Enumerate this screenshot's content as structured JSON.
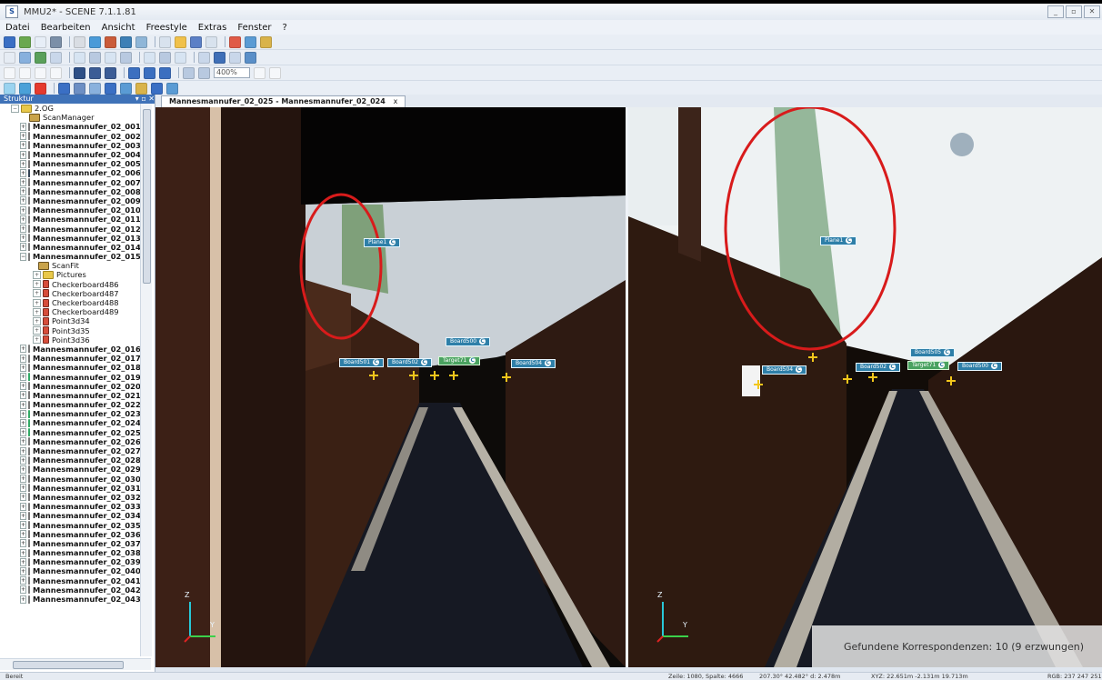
{
  "window": {
    "title": "MMU2* - SCENE 7.1.1.81"
  },
  "menu": [
    "Datei",
    "Bearbeiten",
    "Ansicht",
    "Freestyle",
    "Extras",
    "Fenster",
    "?"
  ],
  "toolbar": {
    "zoom_value": "400%"
  },
  "structure_panel": {
    "title": "Struktur",
    "root": "2.OG",
    "scan_manager": "ScanManager",
    "scans_before": [
      "Mannesmannufer_02_001",
      "Mannesmannufer_02_002",
      "Mannesmannufer_02_003",
      "Mannesmannufer_02_004",
      "Mannesmannufer_02_005",
      "Mannesmannufer_02_006",
      "Mannesmannufer_02_007",
      "Mannesmannufer_02_008",
      "Mannesmannufer_02_009",
      "Mannesmannufer_02_010",
      "Mannesmannufer_02_011",
      "Mannesmannufer_02_012",
      "Mannesmannufer_02_013",
      "Mannesmannufer_02_014",
      "Mannesmannufer_02_015"
    ],
    "expanded_children": [
      "ScanFit",
      "Pictures",
      "Checkerboard486",
      "Checkerboard487",
      "Checkerboard488",
      "Checkerboard489",
      "Point3d34",
      "Point3d35",
      "Point3d36"
    ],
    "scans_after": [
      "Mannesmannufer_02_016",
      "Mannesmannufer_02_017",
      "Mannesmannufer_02_018",
      "Mannesmannufer_02_019",
      "Mannesmannufer_02_020",
      "Mannesmannufer_02_021",
      "Mannesmannufer_02_022",
      "Mannesmannufer_02_023",
      "Mannesmannufer_02_024",
      "Mannesmannufer_02_025",
      "Mannesmannufer_02_026",
      "Mannesmannufer_02_027",
      "Mannesmannufer_02_028",
      "Mannesmannufer_02_029",
      "Mannesmannufer_02_030",
      "Mannesmannufer_02_031",
      "Mannesmannufer_02_032",
      "Mannesmannufer_02_033",
      "Mannesmannufer_02_034",
      "Mannesmannufer_02_035",
      "Mannesmannufer_02_036",
      "Mannesmannufer_02_037",
      "Mannesmannufer_02_038",
      "Mannesmannufer_02_039",
      "Mannesmannufer_02_040",
      "Mannesmannufer_02_041",
      "Mannesmannufer_02_042",
      "Mannesmannufer_02_043"
    ]
  },
  "tab": {
    "label": "Mannesmannufer_02_025 - Mannesmannufer_02_024",
    "close": "x"
  },
  "views": {
    "axis_z": "Z",
    "axis_y": "Y",
    "left_labels": [
      "Plane1",
      "Board501",
      "Board502",
      "Target71",
      "Board500",
      "Board504"
    ],
    "right_labels": [
      "Plane1",
      "Board504",
      "Board502",
      "Target71",
      "Board505",
      "Board500"
    ]
  },
  "overlay": {
    "text": "Gefundene Korrespondenzen: 10 (9 erzwungen)"
  },
  "status": {
    "ready": "Bereit",
    "position": "Zeile: 1080, Spalte: 4666",
    "angles": "207.30° 42.482° d: 2.478m",
    "xyz": "XYZ: 22.651m -2.131m 19.713m",
    "rgb": "RGB: 237 247 251"
  },
  "colors": {
    "accent": "#3f72b8",
    "highlight_circle": "#d81b1b",
    "marker": "#f2c61b"
  }
}
